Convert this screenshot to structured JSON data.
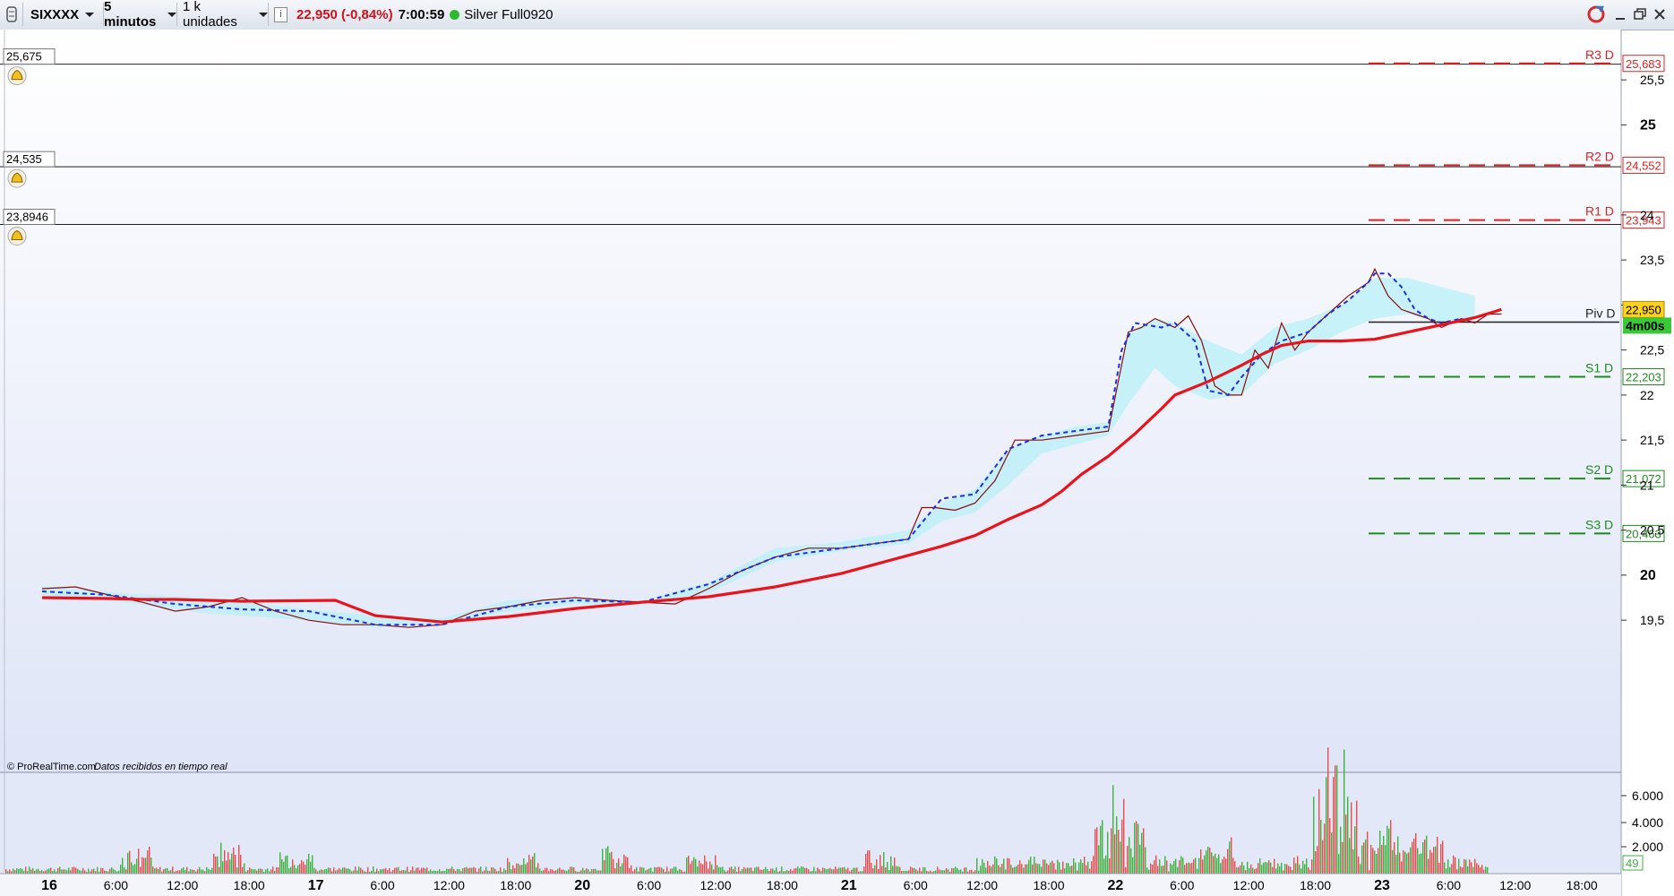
{
  "toolbar": {
    "instrument": "SIXXXX",
    "timeframe": "5 minutos",
    "units": "1 k unidades",
    "info_icon": "info-icon",
    "price_change": "22,950 (-0,84%)",
    "time": "7:00:59",
    "status_dot_color": "#2eb82e",
    "account": "Silver Full0920",
    "window_icons": [
      "refresh-icon",
      "minimize-icon",
      "restore-icon",
      "close-icon"
    ]
  },
  "alerts": [
    {
      "value": "25,675"
    },
    {
      "value": "24,535"
    },
    {
      "value": "23,8946"
    }
  ],
  "pivots": [
    {
      "name": "R3 D",
      "badge": "25,683",
      "kind": "resistance"
    },
    {
      "name": "R2 D",
      "badge": "24,552",
      "kind": "resistance"
    },
    {
      "name": "R1 D",
      "badge": "23,943",
      "kind": "resistance"
    },
    {
      "name": "Piv D",
      "kind": "pivot"
    },
    {
      "name": "S1 D",
      "badge": "22,203",
      "kind": "support"
    },
    {
      "name": "S2 D",
      "badge": "21,072",
      "kind": "support"
    },
    {
      "name": "S3 D",
      "badge": "20,463",
      "kind": "support"
    }
  ],
  "current_price": {
    "badge": "22,950",
    "timer": "4m00s"
  },
  "watermark": {
    "brand": "© ProRealTime.com",
    "note": "Datos recibidos en tiempo real"
  },
  "volume_axis": {
    "ticks": [
      "6.000",
      "4.000",
      "2.000"
    ],
    "current": "49"
  },
  "colors": {
    "resistance": "#e02020",
    "support": "#1f8a1f",
    "ma": "#e8141c",
    "price": "#8b0a0a",
    "dashed": "#1f2fe0",
    "cloud": "#b8f0f8",
    "cloud_green": "#c8f3d3",
    "price_badge": "#ffd21f",
    "timer_badge": "#38c838"
  },
  "chart_data": {
    "type": "line",
    "title": "",
    "y_axis": {
      "range": [
        19.2,
        25.8
      ],
      "ticks": [
        "25,5",
        "25",
        "24",
        "23,5",
        "23",
        "22,5",
        "22",
        "21,5",
        "21",
        "20,5",
        "20",
        "19,5"
      ],
      "bold_ticks": [
        "25",
        "20"
      ]
    },
    "x_axis": {
      "ticks": [
        "16",
        "6:00",
        "12:00",
        "18:00",
        "17",
        "6:00",
        "12:00",
        "18:00",
        "20",
        "6:00",
        "12:00",
        "18:00",
        "21",
        "6:00",
        "12:00",
        "18:00",
        "22",
        "6:00",
        "12:00",
        "18:00",
        "23",
        "6:00",
        "12:00",
        "18:00"
      ],
      "bold_ticks": [
        "16",
        "17",
        "20",
        "21",
        "22",
        "23"
      ]
    },
    "pivot_levels": {
      "R3 D": 25.683,
      "R2 D": 24.552,
      "R1 D": 23.943,
      "Piv D": 22.81,
      "S1 D": 22.203,
      "S2 D": 21.072,
      "S3 D": 20.463
    },
    "alert_levels": [
      25.675,
      24.535,
      23.8946
    ],
    "series": [
      {
        "key": "moving_average",
        "x": [
          0,
          1,
          1.5,
          2,
          3,
          4.4,
          5,
          6,
          7,
          8,
          9,
          10,
          11,
          12,
          13,
          13.5,
          14,
          14.5,
          15,
          15.3,
          15.6,
          16,
          16.4,
          16.8,
          17,
          17.5,
          18,
          18.3,
          18.6,
          19,
          19.5,
          20,
          20.5,
          21,
          21.5,
          21.9
        ],
        "y": [
          19.75,
          19.74,
          19.73,
          19.73,
          19.71,
          19.72,
          19.55,
          19.48,
          19.54,
          19.63,
          19.7,
          19.76,
          19.87,
          20.02,
          20.22,
          20.32,
          20.44,
          20.62,
          20.78,
          20.93,
          21.12,
          21.32,
          21.57,
          21.85,
          22.0,
          22.15,
          22.33,
          22.45,
          22.55,
          22.6,
          22.6,
          22.62,
          22.7,
          22.78,
          22.86,
          22.95
        ]
      },
      {
        "key": "price",
        "x": [
          0,
          0.5,
          1,
          1.5,
          2,
          2.5,
          3,
          3.5,
          4,
          4.5,
          5,
          5.5,
          6,
          6.5,
          7,
          7.5,
          8,
          8.5,
          9,
          9.5,
          10,
          10.5,
          11,
          11.5,
          12,
          12.5,
          13,
          13.2,
          13.4,
          13.7,
          14,
          14.3,
          14.6,
          15,
          15.5,
          16,
          16.3,
          16.5,
          16.7,
          17,
          17.2,
          17.4,
          17.6,
          17.8,
          18,
          18.2,
          18.4,
          18.6,
          18.8,
          19,
          19.3,
          19.6,
          19.9,
          20,
          20.2,
          20.4,
          20.6,
          20.8,
          21,
          21.3,
          21.5,
          21.7,
          21.9
        ],
        "y": [
          19.85,
          19.87,
          19.78,
          19.7,
          19.6,
          19.65,
          19.75,
          19.6,
          19.5,
          19.45,
          19.45,
          19.42,
          19.45,
          19.6,
          19.65,
          19.72,
          19.75,
          19.72,
          19.7,
          19.68,
          19.85,
          20.05,
          20.2,
          20.3,
          20.3,
          20.35,
          20.4,
          20.75,
          20.75,
          20.72,
          20.8,
          21.05,
          21.5,
          21.5,
          21.55,
          21.6,
          22.7,
          22.75,
          22.85,
          22.75,
          22.88,
          22.6,
          22.1,
          22.0,
          22.0,
          22.5,
          22.3,
          22.8,
          22.5,
          22.7,
          22.9,
          23.1,
          23.25,
          23.4,
          23.1,
          22.95,
          22.9,
          22.85,
          22.75,
          22.85,
          22.8,
          22.9,
          22.9
        ]
      },
      {
        "key": "dashed_line",
        "x": [
          0,
          1,
          2,
          3,
          4,
          5,
          6,
          7,
          8,
          9,
          10,
          11,
          12,
          13,
          13.5,
          14,
          14.5,
          15,
          15.5,
          16,
          16.2,
          16.4,
          16.8,
          17,
          17.3,
          17.5,
          17.8,
          18,
          18.3,
          18.6,
          19,
          19.3,
          19.6,
          19.9,
          20,
          20.2,
          20.4,
          20.6,
          20.8,
          21,
          21.3
        ],
        "y": [
          19.82,
          19.78,
          19.68,
          19.62,
          19.6,
          19.45,
          19.45,
          19.65,
          19.72,
          19.7,
          19.9,
          20.2,
          20.3,
          20.4,
          20.85,
          20.9,
          21.4,
          21.55,
          21.6,
          21.65,
          22.5,
          22.8,
          22.75,
          22.8,
          22.6,
          22.05,
          22.0,
          22.2,
          22.45,
          22.6,
          22.7,
          22.9,
          23.05,
          23.25,
          23.35,
          23.35,
          23.2,
          22.95,
          22.85,
          22.8,
          22.85
        ]
      }
    ]
  }
}
